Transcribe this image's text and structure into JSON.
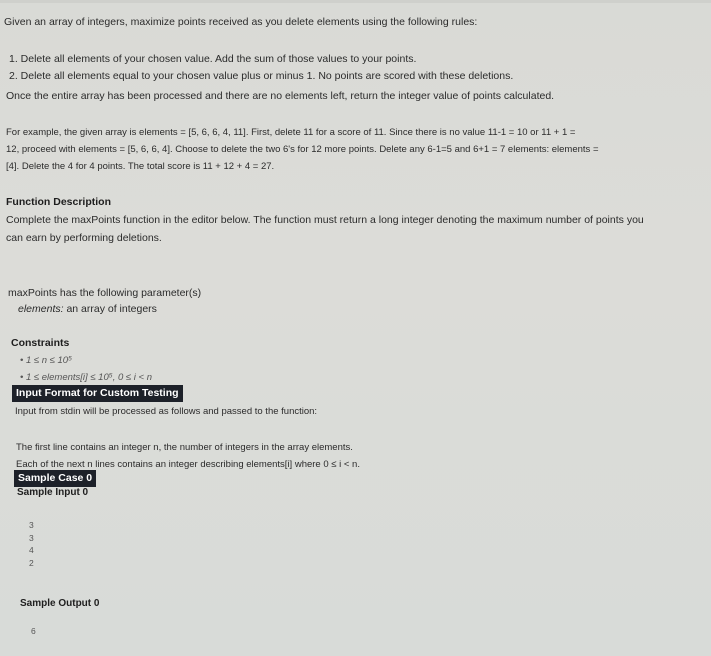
{
  "intro": "Given an array of integers, maximize points received as you delete elements using the following rules:",
  "rules": [
    "1. Delete all elements of your chosen value.  Add the sum of those values to your points.",
    "2. Delete all elements equal to your chosen value plus or minus 1.  No points are scored with these deletions."
  ],
  "conclusion": "Once the entire array has been processed and there are no elements left, return the integer value of points calculated.",
  "example": {
    "line1": "For example, the given array is elements = [5, 6, 6, 4, 11].  First, delete 11 for a score of 11.  Since there is no value 11-1 = 10 or 11 + 1 =",
    "line2": "12, proceed with elements = [5, 6, 6, 4]. Choose to delete the two 6's for 12 more points.  Delete any 6-1=5 and 6+1 = 7 elements: elements =",
    "line3": "[4].  Delete the 4 for 4 points. The total score is 11 + 12 + 4 = 27."
  },
  "function_description": {
    "heading": "Function Description",
    "line1": "Complete the maxPoints function in the editor below. The function must return a long integer denoting the maximum number of points you",
    "line2": "can earn by performing deletions."
  },
  "parameters": {
    "intro": "maxPoints has the following parameter(s)",
    "param_name": "elements:",
    "param_desc": " an array of integers"
  },
  "constraints": {
    "heading": "Constraints",
    "items": [
      "1 ≤ n ≤ 10⁵",
      "1 ≤ elements[i] ≤ 10⁵,  0 ≤ i < n"
    ]
  },
  "input_format": {
    "badge": "Input Format for Custom Testing",
    "line1": "Input from stdin will be processed as follows and passed to the function:",
    "line2": "The first line contains an integer n, the number of integers in the array elements.",
    "line3": "Each of the next n lines contains an integer describing elements[i] where 0 ≤ i < n."
  },
  "sample_case": {
    "badge": "Sample Case 0",
    "input_heading": "Sample Input 0",
    "input_values": [
      "3",
      "3",
      "4",
      "2"
    ],
    "output_heading": "Sample Output 0",
    "output_value": "6"
  }
}
